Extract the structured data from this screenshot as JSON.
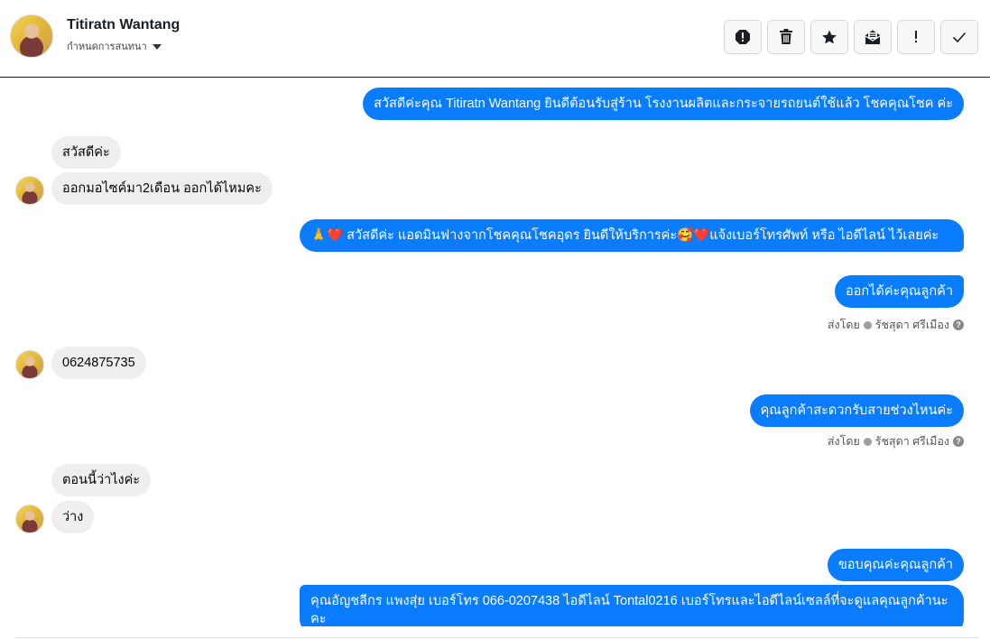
{
  "header": {
    "contact_name": "Titiratn Wantang",
    "subtitle": "กำหนดการสนทนา",
    "actions": [
      {
        "name": "report-icon",
        "glyph": "!"
      },
      {
        "name": "trash-icon",
        "glyph": ""
      },
      {
        "name": "star-icon",
        "glyph": "★"
      },
      {
        "name": "mail-icon",
        "glyph": ""
      },
      {
        "name": "exclaim-icon",
        "glyph": "!"
      },
      {
        "name": "check-icon",
        "glyph": "✓"
      }
    ]
  },
  "colors": {
    "outgoing_bubble": "#0a7cff",
    "incoming_bubble": "#eeeeee"
  },
  "messages": {
    "m1": "สวัสดีค่ะคุณ Titiratn Wantang ยินดีต้อนรับสู่ร้าน โรงงานผลิตและกระจายรถยนต์ใช้แล้ว โชคคุณโชค ค่ะ",
    "m2": "สวัสดีค่ะ",
    "m3": "ออกมอไซค์มา2เดือน ออกได้ไหมคะ",
    "m4_emoji_a": "🙏❤️",
    "m4_text": " สวัสดีค่ะ แอดมินฟางจากโชคคุณโชคอุดร ยินดีให้บริการค่ะ",
    "m4_emoji_b": "🥰❤️",
    "m4_text_b": "แจ้งเบอร์โทรศัพท์ หรือ ไอดีไลน์  ไว้เลยค่ะ",
    "m5": "ออกได้ค่ะคุณลูกค้า",
    "m6": "0624875735",
    "m7": "คุณลูกค้าสะดวกรับสายช่วงไหนค่ะ",
    "m8": "ตอนนี้ว่าไงค่ะ",
    "m9": "ว่าง",
    "m10": "ขอบคุณค่ะคุณลูกค้า",
    "m11": "คุณอัญชลีกร แพงสุ่ย      เบอร์โทร 066-0207438 ไอดีไลน์ Tontal0216  เบอร์โทรและไอดีไลน์เซลล์ที่จะดูแลคุณลูกค้านะคะ"
  },
  "sent_by": {
    "prefix": "ส่งโดย",
    "agent": "รัชสุดา ศรีเมือง"
  }
}
